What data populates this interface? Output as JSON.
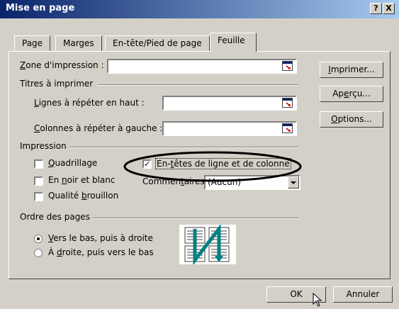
{
  "title": "Mise en page",
  "titlebar": {
    "help": "?",
    "close": "X"
  },
  "tabs": [
    "Page",
    "Marges",
    "En-tête/Pied de page",
    "Feuille"
  ],
  "zone": {
    "label": "Zone d'impression :",
    "value": ""
  },
  "titres": {
    "heading": "Titres à imprimer",
    "haut_label": "Lignes à répéter en haut :",
    "gauche_label": "Colonnes à répéter à gauche :"
  },
  "buttons": {
    "imprimer": "Imprimer...",
    "apercu": "Aperçu...",
    "options": "Options...",
    "ok": "OK",
    "annuler": "Annuler"
  },
  "impression": {
    "heading": "Impression",
    "quadrillage": "Quadrillage",
    "noir_blanc": "En noir et blanc",
    "brouillon": "Qualité brouillon",
    "entetes": "En-têtes de ligne et de colonne",
    "entetes_checked": true,
    "commentaires_label": "Commentaires :",
    "commentaires_value": "(Aucun)"
  },
  "ordre": {
    "heading": "Ordre des pages",
    "option1": "Vers le bas, puis à droite",
    "option2": "À droite, puis vers le bas",
    "selected": 1
  },
  "colors": {
    "title_start": "#0a246a",
    "title_end": "#a6caf0",
    "face": "#d4d0c8",
    "highlight": "#ff0000"
  }
}
